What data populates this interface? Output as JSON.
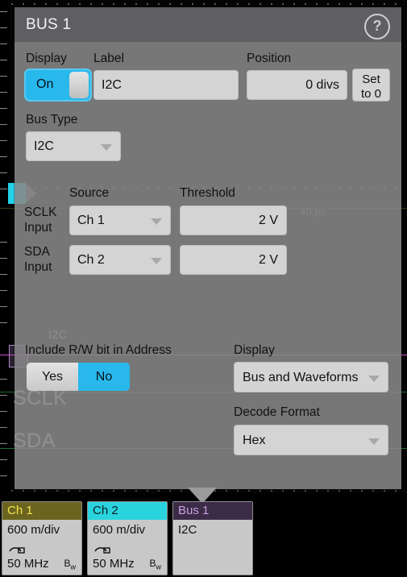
{
  "dialog": {
    "title": "BUS 1",
    "help_icon": "question-mark-icon",
    "display": {
      "label": "Display",
      "toggle_value": "On"
    },
    "label_field": {
      "label": "Label",
      "value": "I2C"
    },
    "position": {
      "label": "Position",
      "value": "0 divs",
      "set_to_zero_line1": "Set",
      "set_to_zero_line2": "to 0"
    },
    "bus_type": {
      "label": "Bus Type",
      "value": "I2C"
    },
    "columns": {
      "source": "Source",
      "threshold": "Threshold"
    },
    "rows": [
      {
        "name_line1": "SCLK",
        "name_line2": "Input",
        "source": "Ch 1",
        "threshold": "2 V"
      },
      {
        "name_line1": "SDA",
        "name_line2": "Input",
        "source": "Ch 2",
        "threshold": "2 V"
      }
    ],
    "rw_bit": {
      "label": "Include R/W bit in Address",
      "option_yes": "Yes",
      "option_no": "No",
      "selected": "No"
    },
    "display_mode": {
      "label": "Display",
      "value": "Bus and Waveforms"
    },
    "decode_format": {
      "label": "Decode Format",
      "value": "Hex"
    }
  },
  "background": {
    "bus_label": "I2C",
    "sclk_label": "SCLK",
    "sda_label": "SDA",
    "timebase": "40 ps"
  },
  "badges": [
    {
      "name": "Ch 1",
      "scale": "600 m/div",
      "bandwidth": "50 MHz",
      "bw_mark": "Bw",
      "probe_icon": "probe-icon",
      "header_bg": "#6b6420",
      "header_fg": "#f2e34a"
    },
    {
      "name": "Ch 2",
      "scale": "600 m/div",
      "bandwidth": "50 MHz",
      "bw_mark": "Bw",
      "probe_icon": "probe-icon",
      "header_bg": "#2ad4de",
      "header_fg": "#0b1f21"
    },
    {
      "name": "Bus 1",
      "scale": "I2C",
      "bandwidth": "",
      "bw_mark": "",
      "probe_icon": "",
      "header_bg": "#3b2b46",
      "header_fg": "#c79ede"
    }
  ],
  "colors": {
    "accent_blue": "#29b8ec",
    "panel_grey": "#888888",
    "title_grey": "#5e5e62",
    "control_grey": "#d4d4d4"
  }
}
